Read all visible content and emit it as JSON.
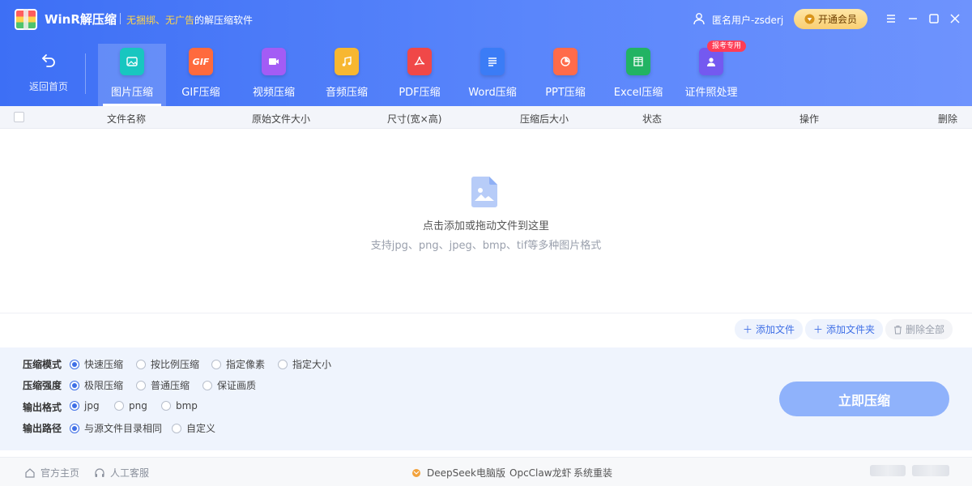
{
  "app": {
    "name": "WinR解压缩",
    "slogan_highlight": "无捆绑、无广告",
    "slogan_rest": "的解压缩软件"
  },
  "user": {
    "name": "匿名用户-zsderj",
    "vip_label": "开通会员"
  },
  "nav": {
    "back_label": "返回首页",
    "tabs": [
      {
        "label": "图片压缩",
        "color": "#18c6c0",
        "icon": "image-icon"
      },
      {
        "label": "GIF压缩",
        "color": "#ff6a3d",
        "icon": "gif-icon",
        "text": "GIF"
      },
      {
        "label": "视频压缩",
        "color": "#a35cf5",
        "icon": "video-icon"
      },
      {
        "label": "音频压缩",
        "color": "#f7b731",
        "icon": "music-icon"
      },
      {
        "label": "PDF压缩",
        "color": "#f04848",
        "icon": "pdf-icon"
      },
      {
        "label": "Word压缩",
        "color": "#3b7cf6",
        "icon": "word-icon"
      },
      {
        "label": "PPT压缩",
        "color": "#ff6b4a",
        "icon": "ppt-icon"
      },
      {
        "label": "Excel压缩",
        "color": "#22b363",
        "icon": "excel-icon"
      },
      {
        "label": "证件照处理",
        "color": "#7459f0",
        "icon": "id-photo-icon"
      }
    ],
    "badge": "报考专用"
  },
  "table": {
    "columns": [
      "文件名称",
      "原始文件大小",
      "尺寸(宽×高)",
      "压缩后大小",
      "状态",
      "操作",
      "删除"
    ]
  },
  "dropzone": {
    "line1": "点击添加或拖动文件到这里",
    "line2": "支持jpg、png、jpeg、bmp、tif等多种图片格式"
  },
  "actions": {
    "add_file": "添加文件",
    "add_folder": "添加文件夹",
    "delete_all": "删除全部"
  },
  "settings": {
    "mode": {
      "label": "压缩模式",
      "options": [
        "快速压缩",
        "按比例压缩",
        "指定像素",
        "指定大小"
      ],
      "selected": 0
    },
    "strength": {
      "label": "压缩强度",
      "options": [
        "极限压缩",
        "普通压缩",
        "保证画质"
      ],
      "selected": 0
    },
    "format": {
      "label": "输出格式",
      "options": [
        "jpg",
        "png",
        "bmp"
      ],
      "selected": 0
    },
    "path": {
      "label": "输出路径",
      "options": [
        "与源文件目录相同",
        "自定义"
      ],
      "selected": 0
    },
    "start_label": "立即压缩"
  },
  "footer": {
    "home": "官方主页",
    "service": "人工客服",
    "deepseek": "DeepSeek电脑版",
    "opcclaw": "OpcClaw龙虾",
    "reinstall": "系统重装"
  }
}
